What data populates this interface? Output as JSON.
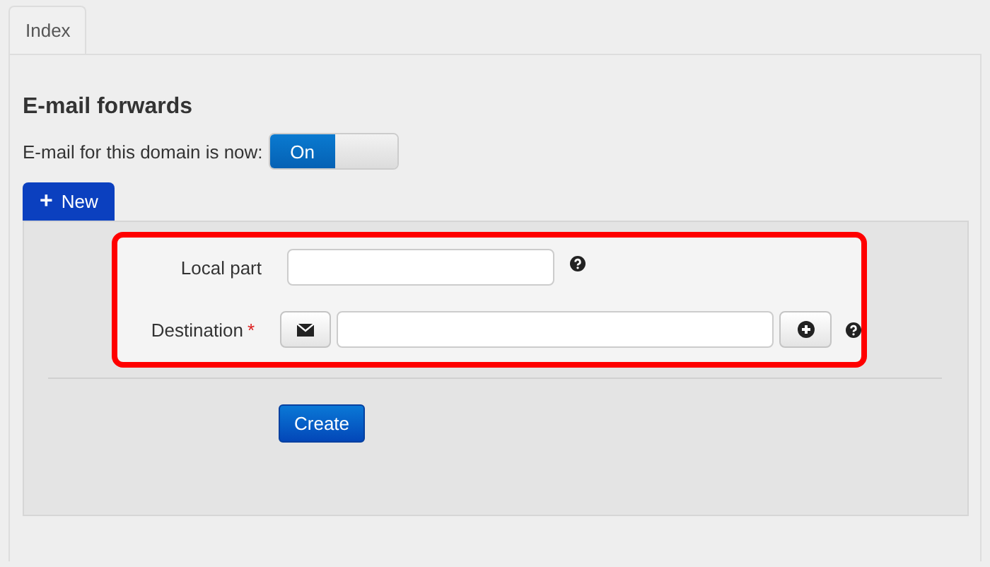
{
  "tabs": [
    {
      "label": "Index",
      "selected": true
    }
  ],
  "heading": "E-mail forwards",
  "status": {
    "label": "E-mail for this domain is now:",
    "toggle_label": "On",
    "on": true
  },
  "new_button": {
    "icon": "+",
    "label": "New"
  },
  "form": {
    "fields": [
      {
        "kind": "text",
        "label": "Local part",
        "required": false
      },
      {
        "kind": "address",
        "label": "Destination",
        "required": true,
        "required_mark": "*"
      }
    ],
    "submit": "Create"
  }
}
